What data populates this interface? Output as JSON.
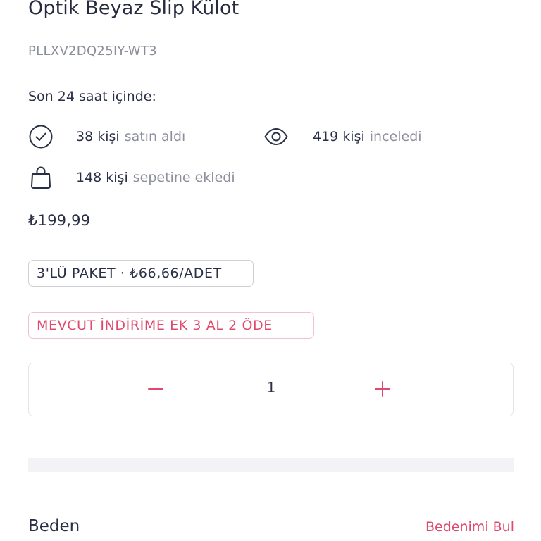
{
  "product": {
    "title": "Optik Beyaz Slip Külot",
    "sku": "PLLXV2DQ25IY-WT3",
    "price": "₺199,99"
  },
  "stats": {
    "heading": "Son 24 saat içinde:",
    "bought": {
      "count": "38 kişi",
      "desc": "satın aldı",
      "icon": "check-circle-icon"
    },
    "viewed": {
      "count": "419 kişi",
      "desc": "inceledi",
      "icon": "eye-icon"
    },
    "basket": {
      "count": "148 kişi",
      "desc": "sepetine ekledi",
      "icon": "shopping-bag-icon"
    }
  },
  "badges": {
    "pack": "3'LÜ PAKET · ₺66,66/ADET",
    "promo": "MEVCUT İNDİRİME EK 3 AL 2 ÖDE"
  },
  "quantity": {
    "value": "1",
    "minus_icon": "minus-icon",
    "plus_icon": "plus-icon"
  },
  "size": {
    "label": "Beden",
    "guide_link": "Bedenimi Bul"
  },
  "colors": {
    "accent": "#e0496e",
    "text": "#2a2f45",
    "muted": "#8d8f9c"
  }
}
